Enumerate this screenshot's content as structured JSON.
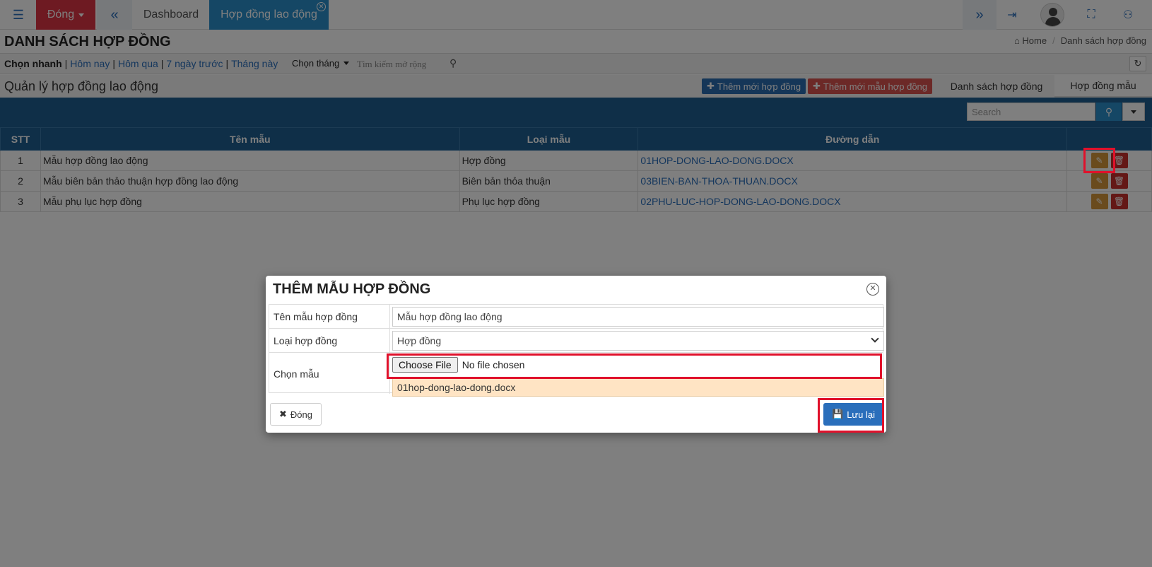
{
  "topbar": {
    "close_menu_label": "Đóng",
    "tabs": [
      {
        "label": "Dashboard"
      },
      {
        "label": "Hợp đồng lao động"
      }
    ]
  },
  "page": {
    "title": "DANH SÁCH HỢP ĐỒNG",
    "breadcrumb": {
      "home": "Home",
      "current": "Danh sách hợp đồng"
    }
  },
  "filter": {
    "quick_label": "Chọn nhanh",
    "options": [
      "Hôm nay",
      "Hôm qua",
      "7 ngày trước",
      "Tháng này"
    ],
    "month_label": "Chọn tháng",
    "search_placeholder": "Tìm kiếm mở rộng"
  },
  "section": {
    "title": "Quản lý hợp đồng lao động",
    "btn_add_contract": "Thêm mới hợp đồng",
    "btn_add_template": "Thêm mới mẫu hợp đồng",
    "tab_list": "Danh sách hợp đồng",
    "tab_templates": "Hợp đồng mẫu"
  },
  "table": {
    "search_placeholder": "Search",
    "headers": [
      "STT",
      "Tên mẫu",
      "Loại mẫu",
      "Đường dẫn"
    ],
    "rows": [
      {
        "stt": "1",
        "name": "Mẫu hợp đồng lao động",
        "type": "Hợp đồng",
        "path": "01HOP-DONG-LAO-DONG.DOCX"
      },
      {
        "stt": "2",
        "name": "Mẫu biên bản thảo thuận hợp đồng lao động",
        "type": "Biên bản thỏa thuận",
        "path": "03BIEN-BAN-THOA-THUAN.DOCX"
      },
      {
        "stt": "3",
        "name": "Mẫu phụ lục hợp đồng",
        "type": "Phụ lục hợp đồng",
        "path": "02PHU-LUC-HOP-DONG-LAO-DONG.DOCX"
      }
    ]
  },
  "modal": {
    "title": "THÊM MẪU HỢP ĐỒNG",
    "name_label": "Tên mẫu hợp đồng",
    "name_value": "Mẫu hợp đồng lao động",
    "type_label": "Loại hợp đồng",
    "type_value": "Hợp đồng",
    "file_label": "Chọn mẫu",
    "choose_file": "Choose File",
    "no_file": "No file chosen",
    "current_file": "01hop-dong-lao-dong.docx",
    "close_label": "Đóng",
    "save_label": "Lưu lại"
  }
}
